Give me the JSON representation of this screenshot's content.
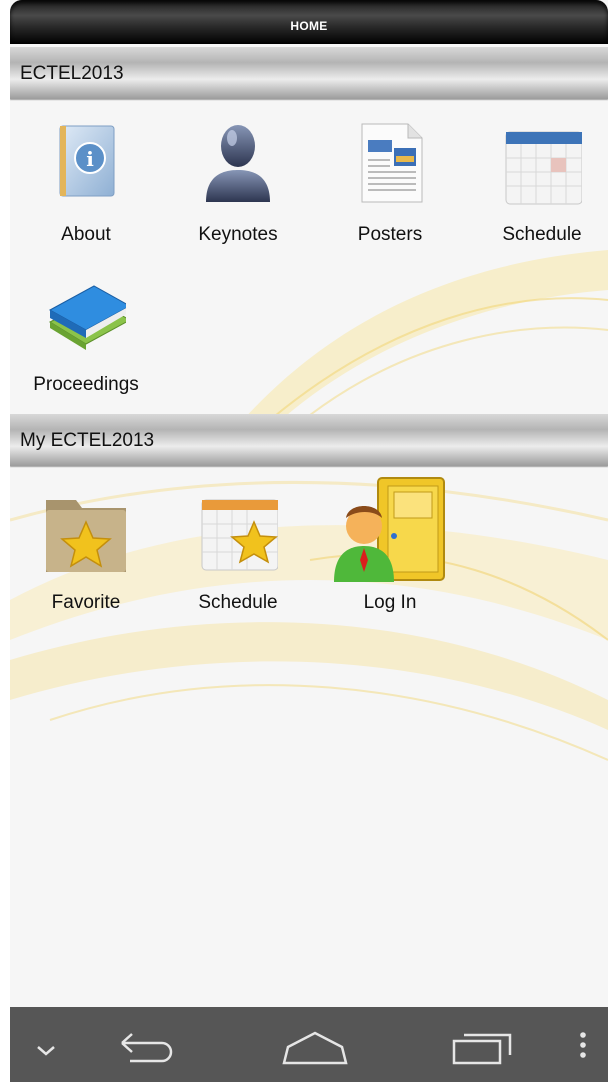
{
  "titlebar": {
    "title": "HOME"
  },
  "sections": {
    "conference": {
      "header": "ECTEL2013",
      "items": [
        {
          "label": "About",
          "icon": "info-book-icon"
        },
        {
          "label": "Keynotes",
          "icon": "person-silhouette-icon"
        },
        {
          "label": "Posters",
          "icon": "poster-document-icon"
        },
        {
          "label": "Schedule",
          "icon": "calendar-icon"
        },
        {
          "label": "Proceedings",
          "icon": "books-icon"
        }
      ]
    },
    "my": {
      "header": "My ECTEL2013",
      "items": [
        {
          "label": "Favorite",
          "icon": "star-folder-icon"
        },
        {
          "label": "Schedule",
          "icon": "starred-calendar-icon"
        },
        {
          "label": "Log In",
          "icon": "user-door-icon"
        }
      ]
    }
  },
  "navbar": {
    "buttons": [
      "chevron-down-icon",
      "back-icon",
      "home-icon",
      "recent-apps-icon",
      "overflow-menu-icon"
    ]
  },
  "colors": {
    "titlebar": "#000000",
    "background": "#f6f6f6",
    "navbar": "#565656",
    "wave_accent": "#f4dc8a"
  }
}
